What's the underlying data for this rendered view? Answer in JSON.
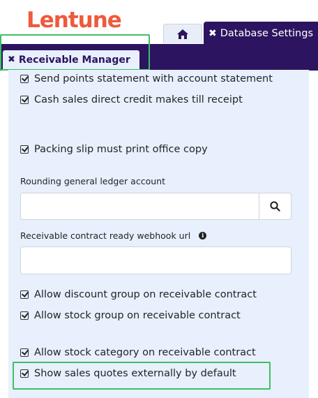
{
  "brand": {
    "logo_text": "Lentune",
    "logo_color": "#ee5a3c"
  },
  "tabs": {
    "home_icon": "home-icon",
    "database_settings": {
      "close": "✖",
      "label": "Database Settings"
    },
    "receivable_manager": {
      "close": "✖",
      "label": "Receivable Manager"
    }
  },
  "settings": {
    "send_points": {
      "label": "Send points statement with account statement",
      "checked": true
    },
    "cash_sales": {
      "label": "Cash sales direct credit makes till receipt",
      "checked": true
    },
    "packing_slip": {
      "label": "Packing slip must print office copy",
      "checked": true
    },
    "rounding_gl": {
      "label": "Rounding general ledger account",
      "value": "",
      "search_icon": "search-icon"
    },
    "webhook": {
      "label": "Receivable contract ready webhook url",
      "info_icon": "info-icon",
      "info_glyph": "i",
      "value": ""
    },
    "allow_discount": {
      "label": "Allow discount group on receivable contract",
      "checked": true
    },
    "allow_stock_group": {
      "label": "Allow stock group on receivable contract",
      "checked": true
    },
    "allow_stock_category": {
      "label": "Allow stock category on receivable contract",
      "checked": true
    },
    "show_quotes": {
      "label": "Show sales quotes externally by default",
      "checked": true
    }
  },
  "colors": {
    "nav_bg": "#2d1460",
    "panel_bg": "#e8f0fd",
    "highlight": "#3cbf64"
  }
}
